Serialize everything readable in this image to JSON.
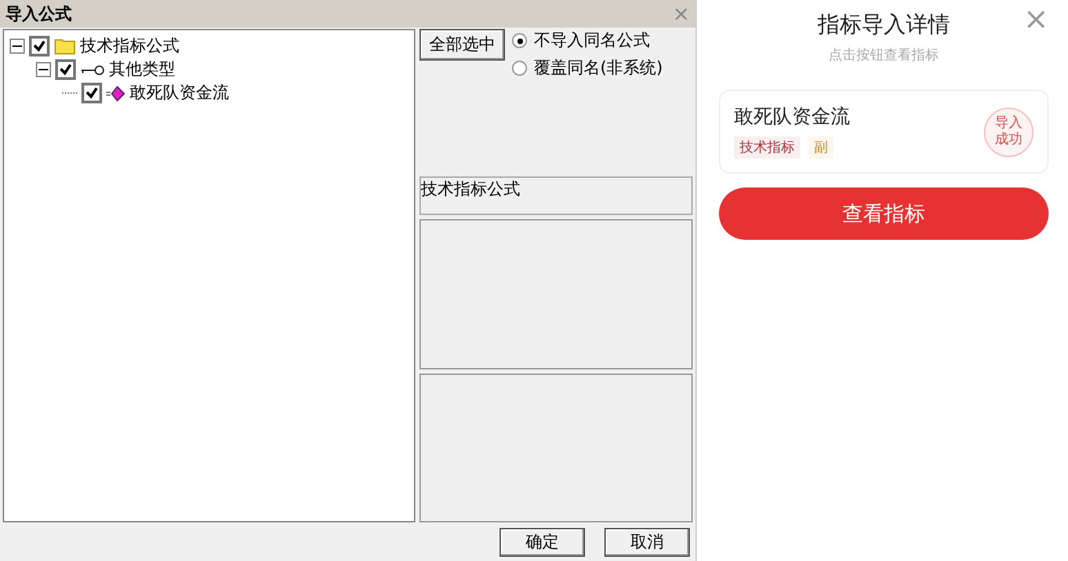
{
  "dialog": {
    "title": "导入公式",
    "close": "×",
    "tree": [
      {
        "label": "技术指标公式",
        "checked": true,
        "kind": "folder",
        "expanded": true,
        "children": [
          {
            "label": "其他类型",
            "checked": true,
            "kind": "key",
            "expanded": true,
            "children": [
              {
                "label": "敢死队资金流",
                "checked": true,
                "kind": "gem"
              }
            ]
          }
        ]
      }
    ],
    "select_all": "全部选中",
    "options": [
      {
        "label": "不导入同名公式",
        "selected": true
      },
      {
        "label": "覆盖同名(非系统)",
        "selected": false
      }
    ],
    "category_field": "技术指标公式",
    "buttons": [
      "确定",
      "取消"
    ]
  },
  "detail": {
    "title": "指标导入详情",
    "subtitle": "点击按钮查看指标",
    "close": "×",
    "card": {
      "name": "敢死队资金流",
      "tags": [
        {
          "label": "技术指标",
          "color": "#b0323a"
        },
        {
          "label": "副",
          "color": "#c9882a"
        }
      ],
      "status": "导入成功"
    },
    "action": "查看指标"
  }
}
